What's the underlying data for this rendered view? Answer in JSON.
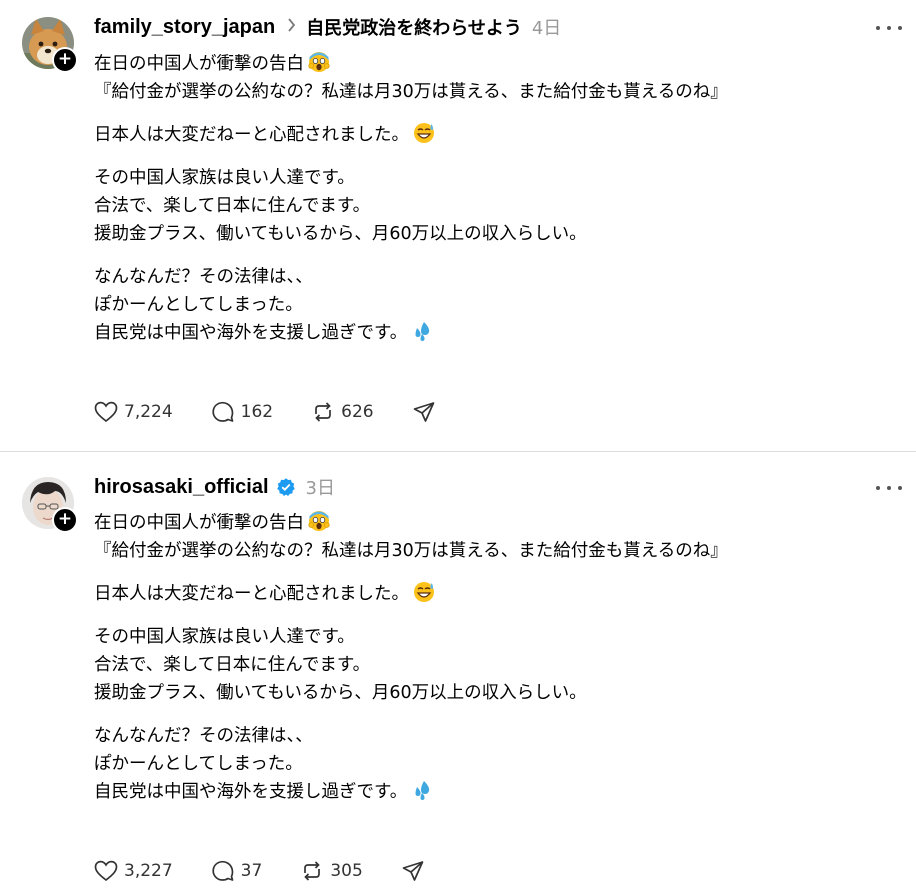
{
  "posts": [
    {
      "username": "family_story_japan",
      "topic": "自民党政治を終わらせよう",
      "time": "4日",
      "lines": {
        "p1a": "在日の中国人が衝撃の告白",
        "p1b": "『給付金が選挙の公約なの？私達は月30万は貰える、また給付金も貰えるのね』",
        "p2": "日本人は大変だねーと心配されました。",
        "p3a": "その中国人家族は良い人達です。",
        "p3b": "合法で、楽して日本に住んでます。",
        "p3c": "援助金プラス、働いてもいるから、月60万以上の収入らしい。",
        "p4a": "なんなんだ？その法律は、、",
        "p4b": "ぽかーんとしてしまった。",
        "p4c": "自民党は中国や海外を支援し過ぎです。"
      },
      "likes": "7,224",
      "replies": "162",
      "reposts": "626"
    },
    {
      "username": "hirosasaki_official",
      "time": "3日",
      "lines": {
        "p1a": "在日の中国人が衝撃の告白",
        "p1b": "『給付金が選挙の公約なの？私達は月30万は貰える、また給付金も貰えるのね』",
        "p2": "日本人は大変だねーと心配されました。",
        "p3a": "その中国人家族は良い人達です。",
        "p3b": "合法で、楽して日本に住んでます。",
        "p3c": "援助金プラス、働いてもいるから、月60万以上の収入らしい。",
        "p4a": "なんなんだ？その法律は、、",
        "p4b": "ぽかーんとしてしまった。",
        "p4c": "自民党は中国や海外を支援し過ぎです。"
      },
      "likes": "3,227",
      "replies": "37",
      "reposts": "305"
    }
  ],
  "icons": {
    "follow": "+",
    "chevron": "chevron-right-icon",
    "verified": "verified-badge-icon",
    "more": "more-icon",
    "like": "heart-icon",
    "reply": "reply-icon",
    "repost": "repost-icon",
    "share": "share-icon",
    "emoji_scream": "scream-emoji",
    "emoji_sweat_smile": "sweat-smile-emoji",
    "emoji_droplets": "sweat-droplets-emoji"
  },
  "colors": {
    "verified": "#1d9bf0",
    "muted": "#999999"
  }
}
